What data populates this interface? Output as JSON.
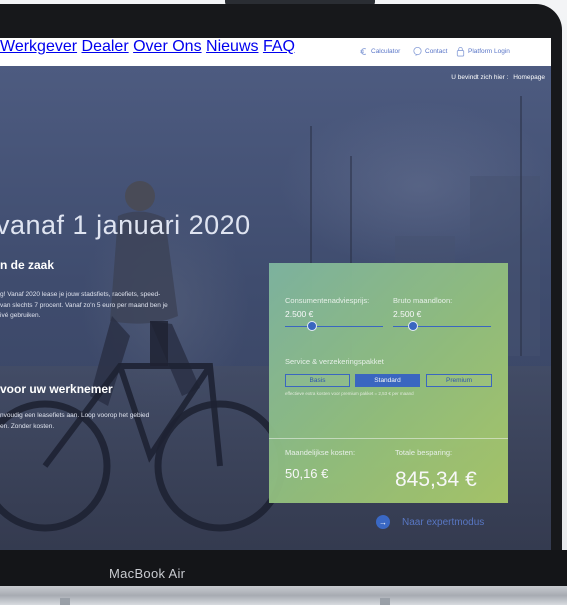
{
  "nav": {
    "items": [
      "Werkgever",
      "Dealer",
      "Over Ons",
      "Nieuws",
      "FAQ"
    ]
  },
  "tools": {
    "calculator": "Calculator",
    "contact": "Contact",
    "login": "Platform Login"
  },
  "breadcrumb": {
    "prefix": "U bevindt zich hier :",
    "current": "Homepage"
  },
  "hero": {
    "headline": "vanaf 1 januari 2020",
    "section1_title": "n de zaak",
    "section1_body": "g! Vanaf 2020 lease je jouw stadsfiets, racefiets, speed-\n van slechts 7 procent. Vanaf zo'n 5 euro per maand ben je\nivé gebruiken.",
    "section2_title": "voor uw werknemer",
    "section2_body": "nvoudig een leasefiets aan. Loop voorop het gebied\nen. Zonder kosten."
  },
  "calculator": {
    "price_label": "Consumentenadviesprijs:",
    "price_value": "2.500 €",
    "price_level": 0.28,
    "salary_label": "Bruto maandloon:",
    "salary_value": "2.500 €",
    "salary_level": 0.2,
    "package_label": "Service & verzekeringspakket",
    "packages": [
      "Basis",
      "Standard",
      "Premium"
    ],
    "selected_package": "Standard",
    "note": "effectieve extra kosten voor premium pakket = 2,53 € per maand",
    "monthly_label": "Maandelijkse kosten:",
    "monthly_value": "50,16 €",
    "savings_label": "Totale besparing:",
    "savings_value": "845,34 €"
  },
  "expert": {
    "label": "Naar expertmodus"
  },
  "device": {
    "brand": "MacBook Air"
  },
  "colors": {
    "accent": "#3a68c4",
    "panel": "#94c07c",
    "nav_text": "#2b3a5e"
  }
}
